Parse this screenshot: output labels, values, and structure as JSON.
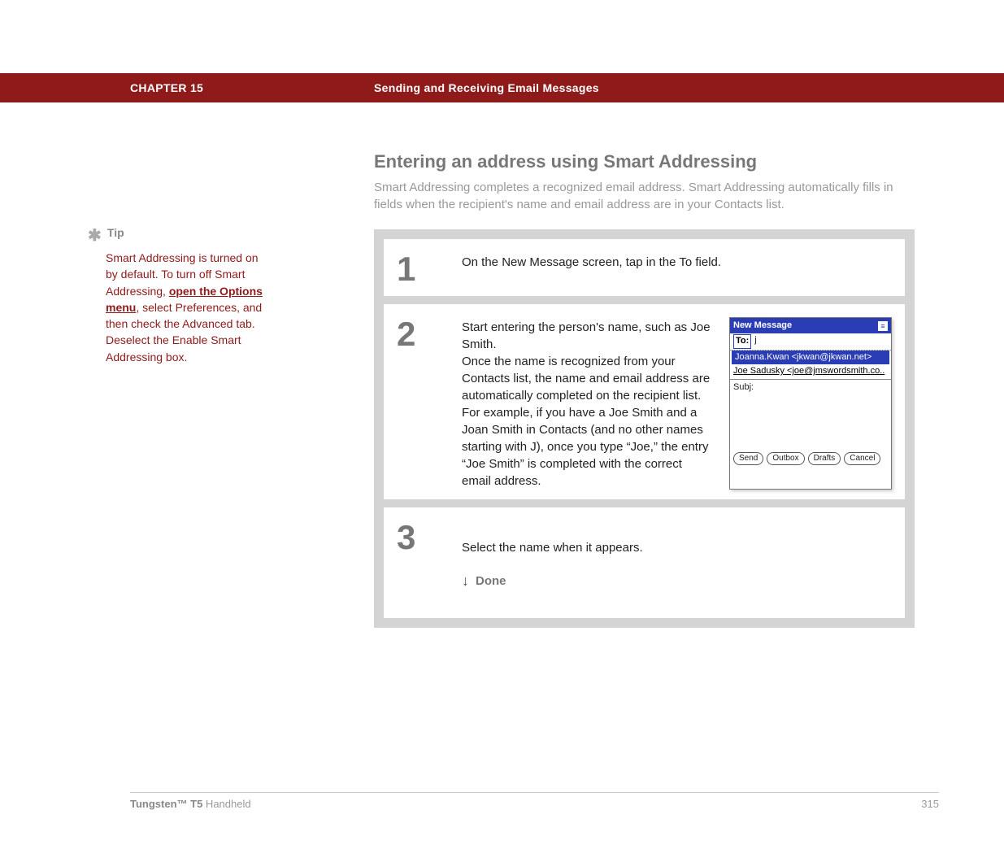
{
  "header": {
    "chapter": "CHAPTER 15",
    "title": "Sending and Receiving Email Messages"
  },
  "section": {
    "title": "Entering an address using Smart Addressing",
    "lead": "Smart Addressing completes a recognized email address. Smart Addressing automatically fills in fields when the recipient's name and email address are in your Contacts list."
  },
  "tip": {
    "label": "Tip",
    "body_prefix": "Smart Addressing is turned on by default. To turn off Smart Addressing, ",
    "link_text": "open the Options menu",
    "body_suffix": ", select Preferences, and then check the Advanced tab. Deselect the Enable Smart Addressing box."
  },
  "steps": [
    {
      "num": "1",
      "text": "On the New Message screen, tap in the To field."
    },
    {
      "num": "2",
      "text": "Start entering the person's name, such as Joe Smith.\nOnce the name is recognized from your Contacts list, the name and email address are automatically completed on the recipient list. For example, if you have a Joe Smith and a Joan Smith in Contacts (and no other names starting with J), once you type “Joe,” the entry “Joe Smith” is completed with the correct email address."
    },
    {
      "num": "3",
      "text": "Select the name when it appears.",
      "done": "Done"
    }
  ],
  "palm": {
    "title": "New Message",
    "to_label": "To:",
    "to_value": "j",
    "dropdown_selected": "Joanna.Kwan <jkwan@jkwan.net>",
    "list_item": "Joe Sadusky <joe@jmswordsmith.co..",
    "subj_label": "Subj:",
    "buttons": [
      "Send",
      "Outbox",
      "Drafts",
      "Cancel"
    ]
  },
  "footer": {
    "product_bold": "Tungsten™ T5",
    "product_rest": " Handheld",
    "page": "315"
  }
}
